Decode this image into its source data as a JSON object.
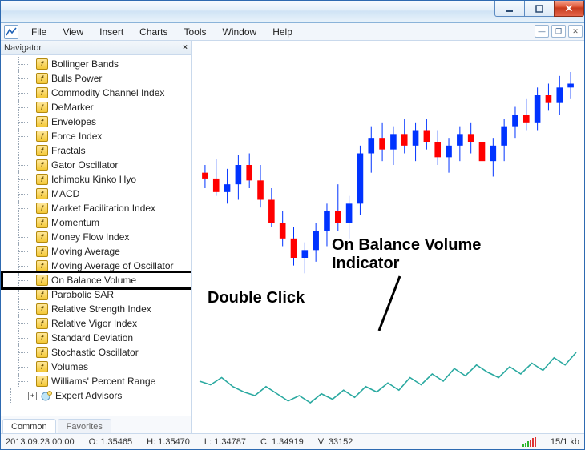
{
  "menu": [
    "File",
    "View",
    "Insert",
    "Charts",
    "Tools",
    "Window",
    "Help"
  ],
  "navigator": {
    "title": "Navigator",
    "tabs": {
      "common": "Common",
      "favorites": "Favorites"
    },
    "indicators": [
      "Bollinger Bands",
      "Bulls Power",
      "Commodity Channel Index",
      "DeMarker",
      "Envelopes",
      "Force Index",
      "Fractals",
      "Gator Oscillator",
      "Ichimoku Kinko Hyo",
      "MACD",
      "Market Facilitation Index",
      "Momentum",
      "Money Flow Index",
      "Moving Average",
      "Moving Average of Oscillator",
      "On Balance Volume",
      "Parabolic SAR",
      "Relative Strength Index",
      "Relative Vigor Index",
      "Standard Deviation",
      "Stochastic Oscillator",
      "Volumes",
      "Williams' Percent Range"
    ],
    "highlighted_index": 15,
    "expert_advisors_label": "Expert Advisors"
  },
  "annotations": {
    "double_click": "Double Click",
    "obv_title": "On Balance Volume\nIndicator"
  },
  "status": {
    "datetime": "2013.09.23 00:00",
    "open_label": "O:",
    "open": "1.35465",
    "high_label": "H:",
    "high": "1.35470",
    "low_label": "L:",
    "low": "1.34787",
    "close_label": "C:",
    "close": "1.34919",
    "vol_label": "V:",
    "vol": "33152",
    "net": "15/1 kb"
  },
  "chart_data": {
    "type": "candlestick+line",
    "candles": [
      {
        "o": 56,
        "h": 60,
        "l": 48,
        "c": 53
      },
      {
        "o": 53,
        "h": 63,
        "l": 44,
        "c": 46
      },
      {
        "o": 46,
        "h": 58,
        "l": 40,
        "c": 50
      },
      {
        "o": 50,
        "h": 65,
        "l": 42,
        "c": 60
      },
      {
        "o": 60,
        "h": 66,
        "l": 48,
        "c": 52
      },
      {
        "o": 52,
        "h": 60,
        "l": 38,
        "c": 42
      },
      {
        "o": 42,
        "h": 48,
        "l": 28,
        "c": 30
      },
      {
        "o": 30,
        "h": 36,
        "l": 18,
        "c": 22
      },
      {
        "o": 22,
        "h": 28,
        "l": 8,
        "c": 12
      },
      {
        "o": 12,
        "h": 20,
        "l": 4,
        "c": 16
      },
      {
        "o": 16,
        "h": 30,
        "l": 10,
        "c": 26
      },
      {
        "o": 26,
        "h": 40,
        "l": 18,
        "c": 36
      },
      {
        "o": 36,
        "h": 50,
        "l": 26,
        "c": 30
      },
      {
        "o": 30,
        "h": 44,
        "l": 22,
        "c": 40
      },
      {
        "o": 40,
        "h": 70,
        "l": 34,
        "c": 66
      },
      {
        "o": 66,
        "h": 80,
        "l": 56,
        "c": 74
      },
      {
        "o": 74,
        "h": 82,
        "l": 62,
        "c": 68
      },
      {
        "o": 68,
        "h": 80,
        "l": 60,
        "c": 76
      },
      {
        "o": 76,
        "h": 84,
        "l": 66,
        "c": 70
      },
      {
        "o": 70,
        "h": 82,
        "l": 62,
        "c": 78
      },
      {
        "o": 78,
        "h": 84,
        "l": 68,
        "c": 72
      },
      {
        "o": 72,
        "h": 78,
        "l": 60,
        "c": 64
      },
      {
        "o": 64,
        "h": 74,
        "l": 56,
        "c": 70
      },
      {
        "o": 70,
        "h": 80,
        "l": 62,
        "c": 76
      },
      {
        "o": 76,
        "h": 82,
        "l": 66,
        "c": 72
      },
      {
        "o": 72,
        "h": 76,
        "l": 58,
        "c": 62
      },
      {
        "o": 62,
        "h": 74,
        "l": 54,
        "c": 70
      },
      {
        "o": 70,
        "h": 84,
        "l": 62,
        "c": 80
      },
      {
        "o": 80,
        "h": 90,
        "l": 74,
        "c": 86
      },
      {
        "o": 86,
        "h": 94,
        "l": 78,
        "c": 82
      },
      {
        "o": 82,
        "h": 100,
        "l": 78,
        "c": 96
      },
      {
        "o": 96,
        "h": 102,
        "l": 88,
        "c": 92
      },
      {
        "o": 92,
        "h": 106,
        "l": 86,
        "c": 100
      },
      {
        "o": 100,
        "h": 108,
        "l": 94,
        "c": 102
      }
    ],
    "obv_line": [
      40,
      36,
      44,
      34,
      28,
      24,
      34,
      26,
      18,
      24,
      16,
      26,
      20,
      30,
      22,
      34,
      28,
      38,
      30,
      44,
      36,
      48,
      40,
      54,
      46,
      58,
      50,
      44,
      56,
      48,
      60,
      52,
      66,
      58,
      72
    ],
    "colors": {
      "up": "#0033ff",
      "down": "#ff0000",
      "obv": "#2aa9a0"
    },
    "candle_y_range": [
      0,
      120
    ],
    "obv_y_range": [
      0,
      80
    ]
  }
}
